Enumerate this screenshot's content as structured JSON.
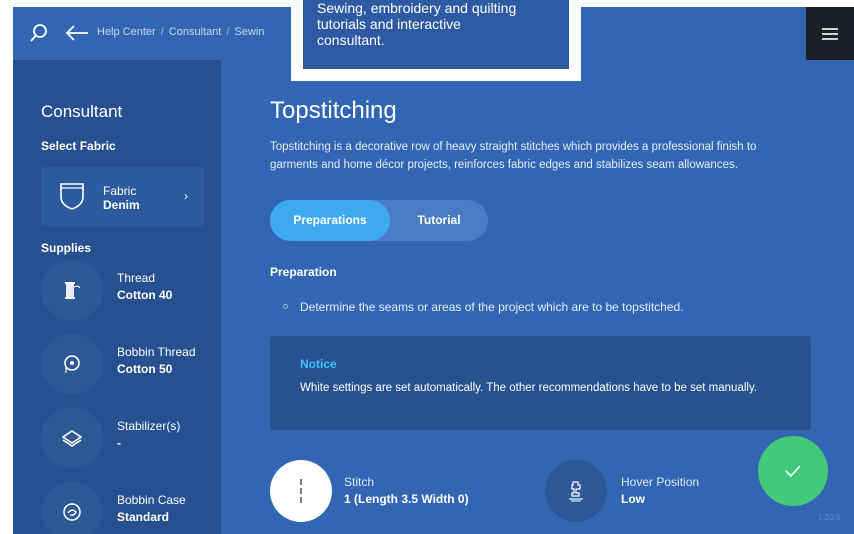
{
  "topbar": {
    "breadcrumb": [
      "Help Center",
      "Consultant",
      "Sewin"
    ],
    "breadcrumb_separator": "/"
  },
  "tooltip": {
    "line1": "Sewing, embroidery and quilting",
    "line2": "tutorials and interactive",
    "line3": "consultant."
  },
  "sidebar": {
    "title": "Consultant",
    "select_fabric_label": "Select Fabric",
    "fabric": {
      "label": "Fabric",
      "value": "Denim",
      "icon": "pocket-icon"
    },
    "supplies_label": "Supplies",
    "supplies": [
      {
        "label": "Thread",
        "value": "Cotton 40",
        "icon": "thread-spool-icon"
      },
      {
        "label": "Bobbin Thread",
        "value": "Cotton 50",
        "icon": "bobbin-icon"
      },
      {
        "label": "Stabilizer(s)",
        "value": "-",
        "icon": "stabilizer-icon"
      },
      {
        "label": "Bobbin Case",
        "value": "Standard",
        "icon": "bobbin-case-icon"
      }
    ]
  },
  "main": {
    "title": "Topstitching",
    "description": "Topstitching is a decorative row of heavy straight stitches which provides a professional finish to garments and home décor projects, reinforces fabric edges and stabilizes seam allowances.",
    "tabs": [
      {
        "label": "Preparations",
        "active": true
      },
      {
        "label": "Tutorial",
        "active": false
      }
    ],
    "preparation_heading": "Preparation",
    "preparation_items": [
      "Determine the seams or areas of the project which are to be topstitched."
    ],
    "notice": {
      "heading": "Notice",
      "text": "White settings are set automatically. The other recommendations have to be set manually."
    },
    "settings": [
      {
        "label": "Stitch",
        "value": "1 (Length 3.5 Width 0)",
        "icon": "straight-stitch-icon"
      },
      {
        "label": "Hover Position",
        "value": "Low",
        "icon": "presser-foot-icon"
      }
    ]
  },
  "version": "1.20.9",
  "colors": {
    "main_bg": "#3266b3",
    "sidebar_bg": "#26508f",
    "active_tab": "#3fa9f0",
    "notice_heading": "#3fc0ff",
    "confirm_button": "#42c97b"
  }
}
